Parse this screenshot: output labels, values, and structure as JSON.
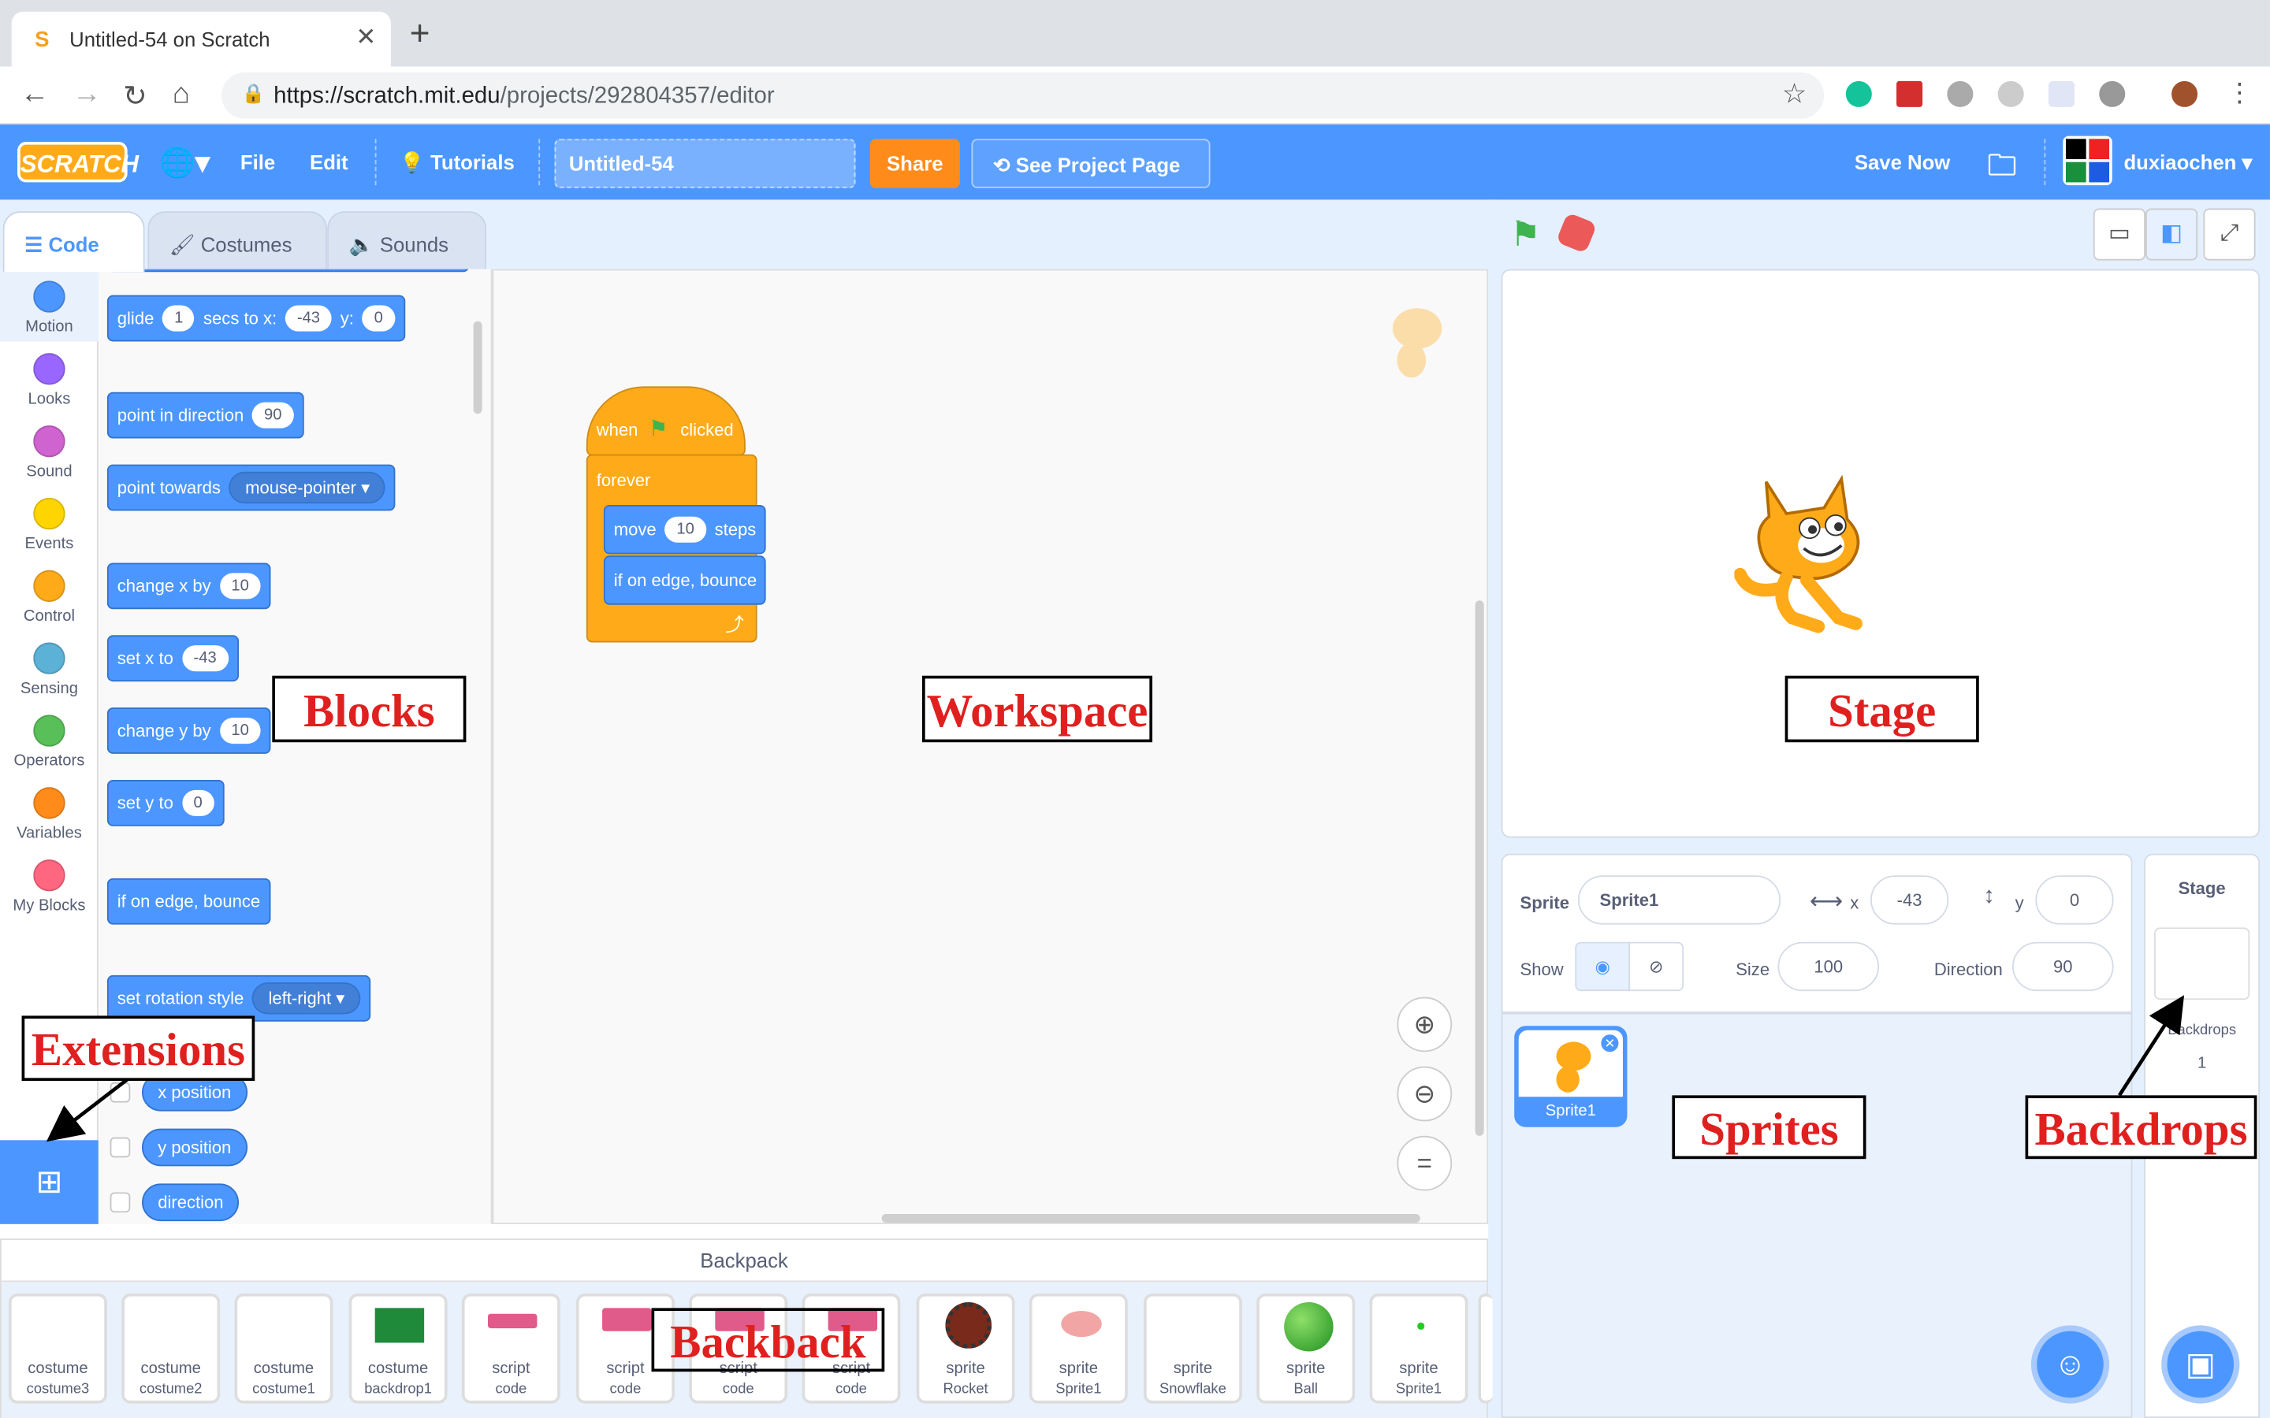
{
  "browser": {
    "tab_title": "Untitled-54 on Scratch",
    "url_host": "https://scratch.mit.edu",
    "url_path": "/projects/292804357/editor"
  },
  "menubar": {
    "logo": "SCRATCH",
    "file": "File",
    "edit": "Edit",
    "tutorials": "Tutorials",
    "project_title": "Untitled-54",
    "share": "Share",
    "see_project_page": "See Project Page",
    "save_now": "Save Now",
    "username": "duxiaochen"
  },
  "editor_tabs": {
    "code": "Code",
    "costumes": "Costumes",
    "sounds": "Sounds"
  },
  "categories": [
    {
      "label": "Motion",
      "color": "#4c97ff"
    },
    {
      "label": "Looks",
      "color": "#9966ff"
    },
    {
      "label": "Sound",
      "color": "#cf63cf"
    },
    {
      "label": "Events",
      "color": "#ffd500"
    },
    {
      "label": "Control",
      "color": "#ffab19"
    },
    {
      "label": "Sensing",
      "color": "#5cb1d6"
    },
    {
      "label": "Operators",
      "color": "#59c059"
    },
    {
      "label": "Variables",
      "color": "#ff8c1a"
    },
    {
      "label": "My Blocks",
      "color": "#ff6680"
    }
  ],
  "blocks": {
    "glide_a": "glide",
    "glide_secs": "1",
    "glide_b": "secs to x:",
    "glide_x": "-43",
    "glide_c": "y:",
    "glide_y": "0",
    "point_dir": "point in direction",
    "point_dir_val": "90",
    "point_towards": "point towards",
    "point_towards_val": "mouse-pointer",
    "change_x": "change x by",
    "change_x_val": "10",
    "set_x": "set x to",
    "set_x_val": "-43",
    "change_y": "change y by",
    "change_y_val": "10",
    "set_y": "set y to",
    "set_y_val": "0",
    "edge_bounce": "if on edge, bounce",
    "rot_style": "set rotation style",
    "rot_style_val": "left-right",
    "x_position": "x position",
    "y_position": "y position",
    "direction": "direction"
  },
  "script": {
    "when": "when",
    "clicked": "clicked",
    "forever": "forever",
    "move": "move",
    "move_val": "10",
    "steps": "steps",
    "bounce": "if on edge, bounce"
  },
  "sprite_info": {
    "sprite_label": "Sprite",
    "sprite_name": "Sprite1",
    "x_label": "x",
    "x_val": "-43",
    "y_label": "y",
    "y_val": "0",
    "show_label": "Show",
    "size_label": "Size",
    "size_val": "100",
    "direction_label": "Direction",
    "direction_val": "90"
  },
  "sprites": [
    {
      "name": "Sprite1"
    }
  ],
  "stage_panel": {
    "title": "Stage",
    "backdrops_label": "Backdrops",
    "backdrops_count": "1"
  },
  "backpack": {
    "title": "Backpack",
    "items": [
      {
        "type": "costume",
        "name": "costume3"
      },
      {
        "type": "costume",
        "name": "costume2"
      },
      {
        "type": "costume",
        "name": "costume1"
      },
      {
        "type": "costume",
        "name": "backdrop1"
      },
      {
        "type": "script",
        "name": "code"
      },
      {
        "type": "script",
        "name": "code"
      },
      {
        "type": "script",
        "name": "code"
      },
      {
        "type": "script",
        "name": "code"
      },
      {
        "type": "sprite",
        "name": "Rocket"
      },
      {
        "type": "sprite",
        "name": "Sprite1"
      },
      {
        "type": "sprite",
        "name": "Snowflake"
      },
      {
        "type": "sprite",
        "name": "Ball"
      },
      {
        "type": "sprite",
        "name": "Sprite1"
      }
    ]
  },
  "annotations": {
    "blocks": "Blocks",
    "workspace": "Workspace",
    "stage": "Stage",
    "extensions": "Extensions",
    "sprites": "Sprites",
    "backdrops": "Backdrops",
    "backpack": "Backback"
  },
  "colors": {
    "scratch_blue": "#4c97ff",
    "control_orange": "#ffab19",
    "share_orange": "#ff8c1a",
    "annotation_red": "#e0201f"
  }
}
